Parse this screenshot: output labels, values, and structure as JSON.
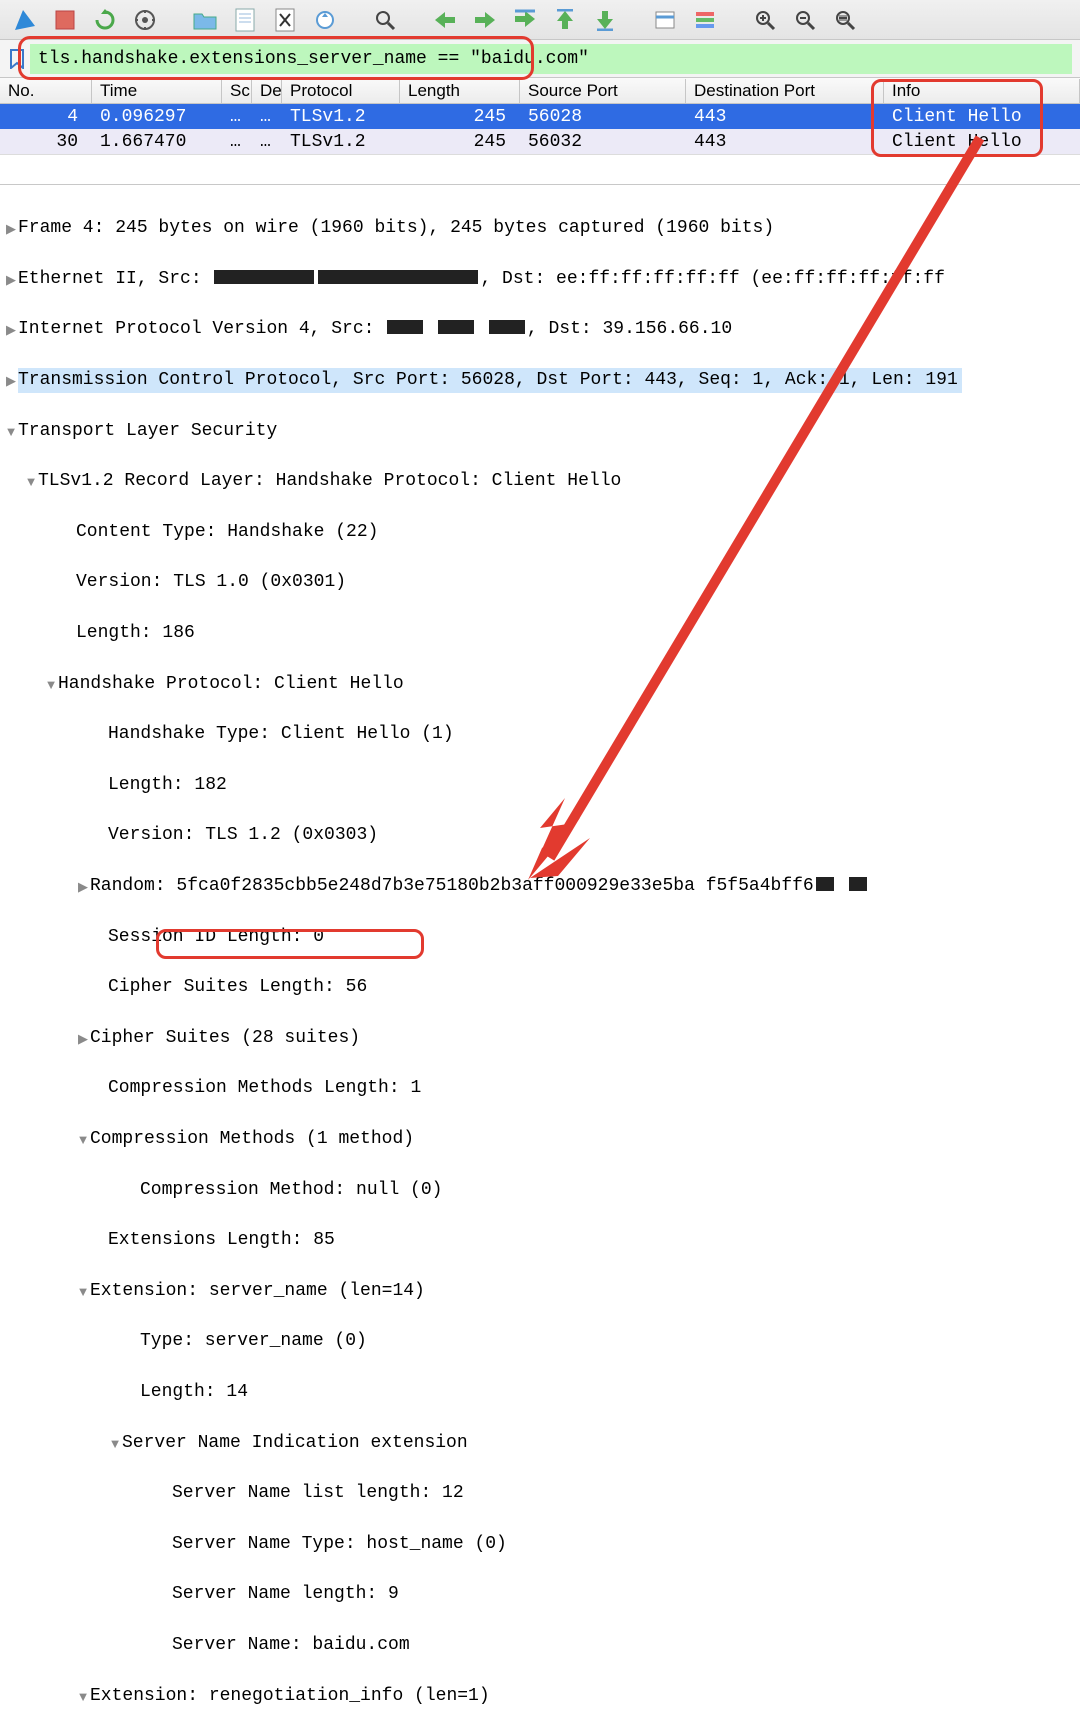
{
  "filter": "tls.handshake.extensions_server_name == \"baidu.com\"",
  "columns": {
    "no": "No.",
    "time": "Time",
    "src": "Sc",
    "dst": "De",
    "proto": "Protocol",
    "len": "Length",
    "sport": "Source Port",
    "dport": "Destination Port",
    "info": "Info"
  },
  "rows": [
    {
      "no": "4",
      "time": "0.096297",
      "src": "…",
      "dst": "…",
      "proto": "TLSv1.2",
      "len": "245",
      "sport": "56028",
      "dport": "443",
      "info": "Client Hello"
    },
    {
      "no": "30",
      "time": "1.667470",
      "src": "…",
      "dst": "…",
      "proto": "TLSv1.2",
      "len": "245",
      "sport": "56032",
      "dport": "443",
      "info": "Client Hello"
    }
  ],
  "details": {
    "frame": "Frame 4: 245 bytes on wire (1960 bits), 245 bytes captured (1960 bits)",
    "eth_a": "Ethernet II, Src: ",
    "eth_b": ", Dst: ee:ff:ff:ff:ff:ff (ee:ff:ff:ff:ff:ff",
    "ip_a": "Internet Protocol Version 4, Src: ",
    "ip_b": ", Dst: 39.156.66.10",
    "tcp": "Transmission Control Protocol, Src Port: 56028, Dst Port: 443, Seq: 1, Ack: 1, Len: 191",
    "tls": "Transport Layer Security",
    "rec": "TLSv1.2 Record Layer: Handshake Protocol: Client Hello",
    "ctype": "Content Type: Handshake (22)",
    "ver1": "Version: TLS 1.0 (0x0301)",
    "len1": "Length: 186",
    "hs": "Handshake Protocol: Client Hello",
    "hstype": "Handshake Type: Client Hello (1)",
    "hslen": "Length: 182",
    "ver2": "Version: TLS 1.2 (0x0303)",
    "rand": "Random: 5fca0f2835cbb5e248d7b3e75180b2b3aff000929e33e5ba f5f5a4bff6",
    "sidlen": "Session ID Length: 0",
    "cslen": "Cipher Suites Length: 56",
    "cs": "Cipher Suites (28 suites)",
    "cmlen": "Compression Methods Length: 1",
    "cm": "Compression Methods (1 method)",
    "cmnull": "Compression Method: null (0)",
    "extlen": "Extensions Length: 85",
    "extsn": "Extension: server_name (len=14)",
    "sntype": "Type: server_name (0)",
    "snlen": "Length: 14",
    "sni": "Server Name Indication extension",
    "snlist": "Server Name list length: 12",
    "snt": "Server Name Type: host_name (0)",
    "snl": "Server Name length: 9",
    "sname": "Server Name: baidu.com",
    "extreneg": "Extension: renegotiation_info (len=1)"
  }
}
